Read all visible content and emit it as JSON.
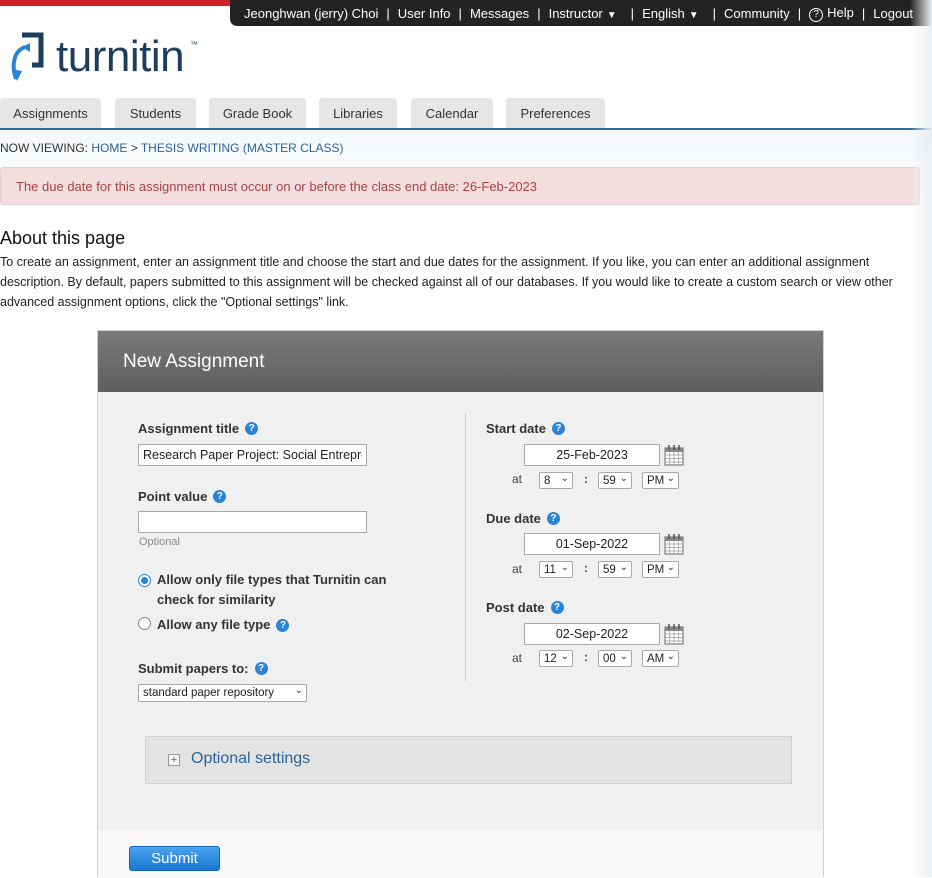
{
  "topbar": {
    "user": "Jeonghwan (jerry) Choi",
    "user_info": "User Info",
    "messages": "Messages",
    "role": "Instructor",
    "language": "English",
    "community": "Community",
    "help": "Help",
    "logout": "Logout"
  },
  "logo": {
    "text": "turnitin",
    "tm": "™"
  },
  "tabs": [
    "Assignments",
    "Students",
    "Grade Book",
    "Libraries",
    "Calendar",
    "Preferences"
  ],
  "breadcrumb": {
    "prefix": "NOW VIEWING:",
    "home": "HOME",
    "separator": ">",
    "current": "THESIS WRITING (MASTER CLASS)"
  },
  "alert": "The due date for this assignment must occur on or before the class end date: 26-Feb-2023",
  "about": {
    "title": "About this page",
    "text": "To create an assignment, enter an assignment title and choose the start and due dates for the assignment. If you like, you can enter an additional assignment description. By default, papers submitted to this assignment will be checked against all of our databases. If you would like to create a custom search or view other advanced assignment options, click the \"Optional settings\" link."
  },
  "form": {
    "header": "New Assignment",
    "title_label": "Assignment title",
    "title_value": "Research Paper Project: Social Entrepreneurship",
    "point_label": "Point value",
    "point_value": "",
    "point_hint": "Optional",
    "filetype_option1_line1": "Allow only file types that Turnitin can",
    "filetype_option1_line2": "check for similarity",
    "filetype_option2": "Allow any file type",
    "submit_to_label": "Submit papers to:",
    "submit_to_value": "standard paper repository",
    "start": {
      "label": "Start date",
      "date": "25-Feb-2023",
      "at": "at",
      "sep": ":",
      "hour": "8",
      "minute": "59",
      "ampm": "PM"
    },
    "due": {
      "label": "Due date",
      "date": "01-Sep-2022",
      "at": "at",
      "sep": ":",
      "hour": "11",
      "minute": "59",
      "ampm": "PM"
    },
    "post": {
      "label": "Post date",
      "date": "02-Sep-2022",
      "at": "at",
      "sep": ":",
      "hour": "12",
      "minute": "00",
      "ampm": "AM"
    },
    "optional_settings": "Optional settings",
    "submit_label": "Submit",
    "help_glyph": "?",
    "plus_glyph": "+",
    "caret_glyph": "▼",
    "chevron_glyph": "⌄"
  },
  "colors": {
    "brand_red": "#cc2127",
    "brand_navy": "#1c3e5c",
    "link": "#2a6496",
    "accent_blue": "#2a84d6",
    "alert_text": "#a94442"
  }
}
